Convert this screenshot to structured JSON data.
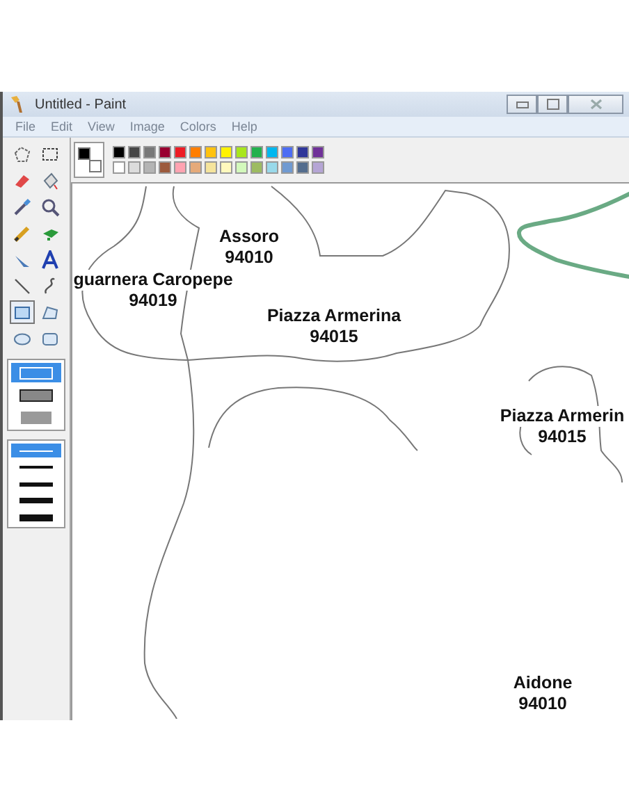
{
  "window": {
    "title": "Untitled - Paint"
  },
  "menu": [
    "File",
    "Edit",
    "View",
    "Image",
    "Colors",
    "Help"
  ],
  "tools": [
    {
      "selected": false
    },
    {
      "selected": false
    },
    {
      "selected": false
    },
    {
      "selected": false
    },
    {
      "selected": false
    },
    {
      "selected": false
    },
    {
      "selected": false
    },
    {
      "selected": false
    },
    {
      "selected": false
    },
    {
      "selected": false
    },
    {
      "selected": false
    },
    {
      "selected": false
    },
    {
      "selected": true
    },
    {
      "selected": false
    },
    {
      "selected": false
    },
    {
      "selected": false
    }
  ],
  "fill_styles": [
    {
      "kind": "outline",
      "selected": true
    },
    {
      "kind": "outline-fill",
      "selected": false
    },
    {
      "kind": "fill",
      "selected": false
    }
  ],
  "line_widths": [
    {
      "selected": true
    },
    {
      "selected": false
    },
    {
      "selected": false
    },
    {
      "selected": false
    },
    {
      "selected": false
    }
  ],
  "current_colors": [
    {
      "color": "#000000"
    },
    {
      "color": "#ffffff"
    }
  ],
  "palette": [
    {
      "color": "#000000"
    },
    {
      "color": "#464646"
    },
    {
      "color": "#787878"
    },
    {
      "color": "#990030"
    },
    {
      "color": "#ed1c24"
    },
    {
      "color": "#ff7e00"
    },
    {
      "color": "#ffc20e"
    },
    {
      "color": "#fff200"
    },
    {
      "color": "#a8e61d"
    },
    {
      "color": "#22b14c"
    },
    {
      "color": "#00b7ef"
    },
    {
      "color": "#4d6df3"
    },
    {
      "color": "#2f3699"
    },
    {
      "color": "#6f3198"
    },
    {
      "color": "#ffffff"
    },
    {
      "color": "#dcdcdc"
    },
    {
      "color": "#b4b4b4"
    },
    {
      "color": "#9c5a3c"
    },
    {
      "color": "#ffa3b1"
    },
    {
      "color": "#e5aa7a"
    },
    {
      "color": "#f5e49c"
    },
    {
      "color": "#fff9bd"
    },
    {
      "color": "#d3f9bc"
    },
    {
      "color": "#9dbb61"
    },
    {
      "color": "#99d9ea"
    },
    {
      "color": "#709ad1"
    },
    {
      "color": "#546d8e"
    },
    {
      "color": "#b5a5d5"
    }
  ],
  "map_labels": [
    {
      "name": "Assoro",
      "code": "94010"
    },
    {
      "name": "guarnera Caropepe",
      "code": "94019"
    },
    {
      "name": "Piazza Armerina",
      "code": "94015"
    },
    {
      "name": "Piazza Armerin",
      "code": "94015"
    },
    {
      "name": "Aidone",
      "code": "94010"
    }
  ]
}
